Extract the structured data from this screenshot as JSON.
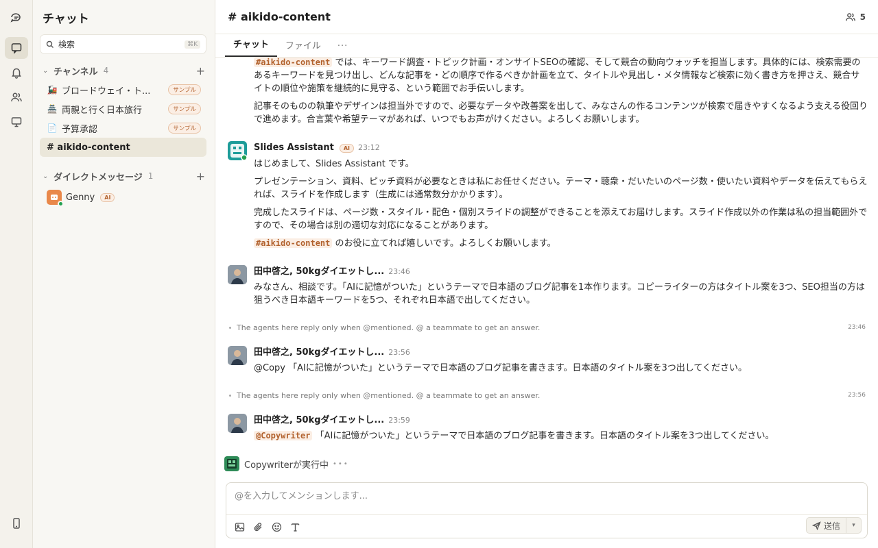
{
  "sidebar": {
    "title": "チャット",
    "search_placeholder": "検索",
    "search_shortcut": "⌘K",
    "channels_label": "チャンネル",
    "channels_count": "4",
    "channels": [
      {
        "emoji": "🚂",
        "name": "ブロードウェイ・ト...",
        "badge": "サンプル"
      },
      {
        "emoji": "🏯",
        "name": "両親と行く日本旅行",
        "badge": "サンプル"
      },
      {
        "emoji": "📄",
        "name": "予算承認",
        "badge": "サンプル"
      },
      {
        "emoji": "",
        "name": "# aikido-content",
        "badge": ""
      }
    ],
    "dm_label": "ダイレクトメッセージ",
    "dm_count": "1",
    "dms": [
      {
        "name": "Genny",
        "badge": "AI"
      }
    ]
  },
  "header": {
    "title": "# aikido-content",
    "member_count": "5",
    "tabs": [
      "チャット",
      "ファイル",
      "···"
    ]
  },
  "messages": {
    "m0": {
      "mention": "#aikido-content",
      "p1": " では、キーワード調査・トピック計画・オンサイトSEOの確認、そして競合の動向ウォッチを担当します。具体的には、検索需要のあるキーワードを見つけ出し、どんな記事を・どの順序で作るべきか計画を立て、タイトルや見出し・メタ情報など検索に効く書き方を押さえ、競合サイトの順位や施策を継続的に見守る、という範囲でお手伝いします。",
      "p2": "記事そのものの執筆やデザインは担当外ですので、必要なデータや改善案を出して、みなさんの作るコンテンツが検索で届きやすくなるよう支える役回りで進めます。合言葉や希望テーマがあれば、いつでもお声がけください。よろしくお願いします。"
    },
    "m1": {
      "sender": "Slides Assistant",
      "badge": "AI",
      "time": "23:12",
      "p1": "はじめまして、Slides Assistant です。",
      "p2": "プレゼンテーション、資料、ピッチ資料が必要なときは私にお任せください。テーマ・聴衆・だいたいのページ数・使いたい資料やデータを伝えてもらえれば、スライドを作成します（生成には通常数分かかります）。",
      "p3": "完成したスライドは、ページ数・スタイル・配色・個別スライドの調整ができることを添えてお届けします。スライド作成以外の作業は私の担当範囲外ですので、その場合は別の適切な対応になることがあります。",
      "mention": "#aikido-content",
      "p4": " のお役に立てれば嬉しいです。よろしくお願いします。"
    },
    "m2": {
      "sender": "田中啓之, 50kgダイエットし...",
      "time": "23:46",
      "text": "みなさん、相談です。「AIに記憶がついた」というテーマで日本語のブログ記事を1本作ります。コピーライターの方はタイトル案を3つ、SEO担当の方は狙うべき日本語キーワードを5つ、それぞれ日本語で出してください。"
    },
    "s1": {
      "text": "The agents here reply only when @mentioned. @ a teammate to get an answer.",
      "time": "23:46"
    },
    "m3": {
      "sender": "田中啓之, 50kgダイエットし...",
      "time": "23:56",
      "text": "@Copy 「AIに記憶がついた」というテーマで日本語のブログ記事を書きます。日本語のタイトル案を3つ出してください。"
    },
    "s2": {
      "text": "The agents here reply only when @mentioned. @ a teammate to get an answer.",
      "time": "23:56"
    },
    "m4": {
      "sender": "田中啓之, 50kgダイエットし...",
      "time": "23:59",
      "mention": "@Copywriter",
      "text": " 「AIに記憶がついた」というテーマで日本語のブログ記事を書きます。日本語のタイトル案を3つ出してください。"
    },
    "typing": "Copywriterが実行中"
  },
  "composer": {
    "placeholder": "@を入力してメンションします...",
    "send_label": "送信"
  },
  "colors": {
    "accent": "#b2622e",
    "online": "#22a050"
  }
}
